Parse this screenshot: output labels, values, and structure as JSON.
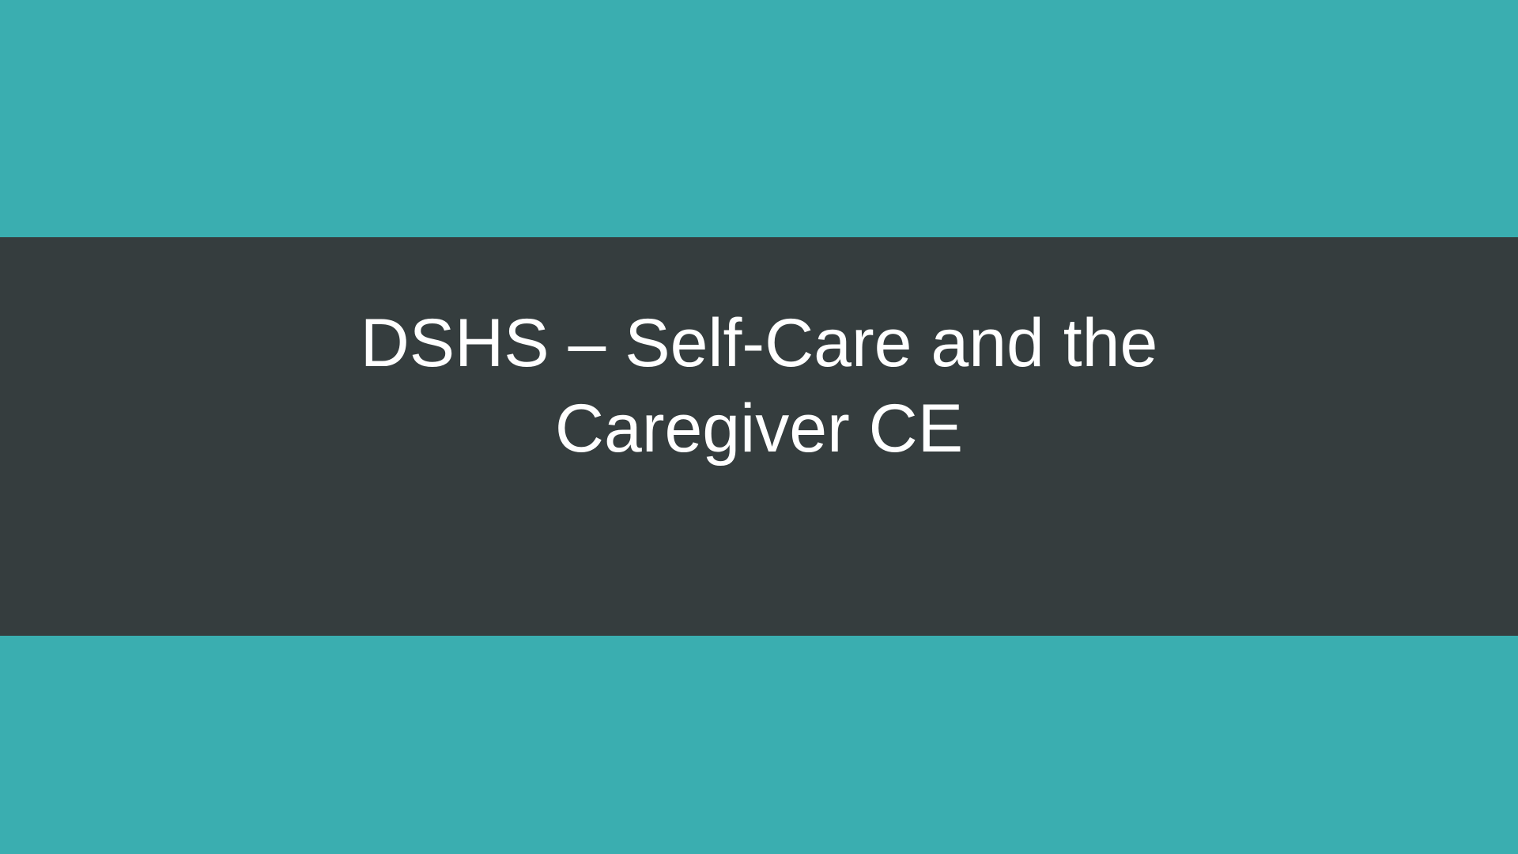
{
  "slide": {
    "title_line_1": "DSHS – Self-Care and the",
    "title_line_2": "Caregiver CE"
  },
  "colors": {
    "accent_band": "#3aaeb0",
    "title_band": "#353d3e",
    "title_text": "#ffffff"
  }
}
